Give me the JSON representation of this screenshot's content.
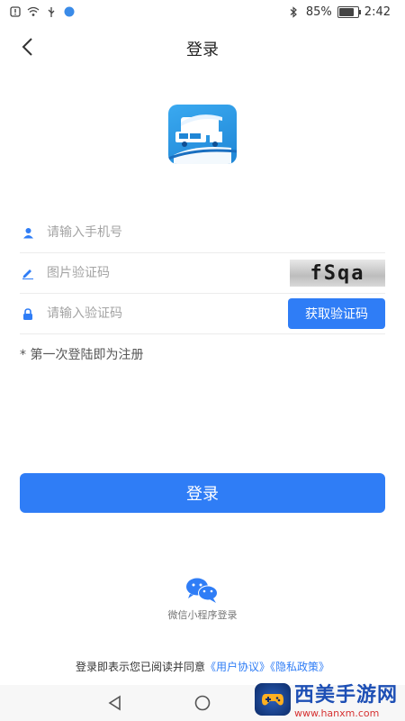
{
  "status": {
    "battery": "85%",
    "time": "2:42"
  },
  "header": {
    "title": "登录"
  },
  "form": {
    "phone_placeholder": "请输入手机号",
    "image_code_placeholder": "图片验证码",
    "captcha_text": "fSqa",
    "sms_code_placeholder": "请输入验证码",
    "get_code_label": "获取验证码"
  },
  "note": "* 第一次登陆即为注册",
  "login_label": "登录",
  "wechat_label": "微信小程序登录",
  "agreement": {
    "prefix": "登录即表示您已阅读并同意",
    "user_agreement": "《用户协议》",
    "privacy_policy": "《隐私政策》"
  },
  "watermark": {
    "title": "西美手游网",
    "url": "www.hanxm.com"
  },
  "colors": {
    "accent": "#2f7df6"
  }
}
